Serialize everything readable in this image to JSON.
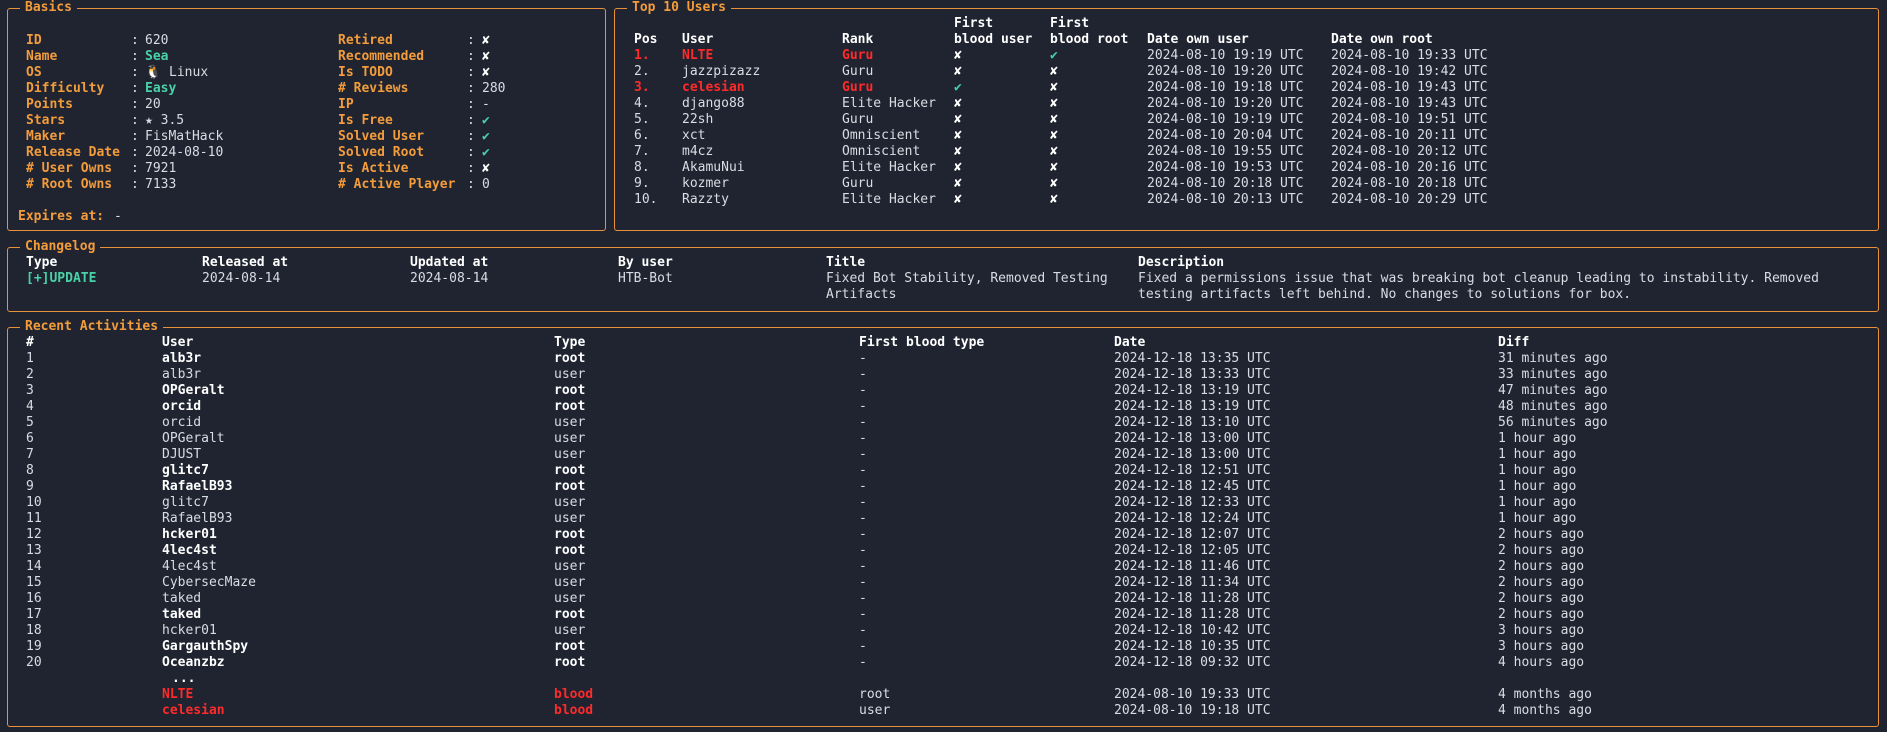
{
  "colors": {
    "accent": "#f39c3c",
    "positive": "#49d2a7",
    "danger": "#ff2a2a",
    "background": "#1f2430"
  },
  "basics": {
    "title": "Basics",
    "left": [
      {
        "label": "ID",
        "value": "620"
      },
      {
        "label": "Name",
        "value": "Sea"
      },
      {
        "label": "OS",
        "value": "🐧 Linux"
      },
      {
        "label": "Difficulty",
        "value": "Easy"
      },
      {
        "label": "Points",
        "value": "20"
      },
      {
        "label": "Stars",
        "value": "★ 3.5"
      },
      {
        "label": "Maker",
        "value": "FisMatHack"
      },
      {
        "label": "Release Date",
        "value": "2024-08-10"
      },
      {
        "label": "# User Owns",
        "value": "7921"
      },
      {
        "label": "# Root Owns",
        "value": "7133"
      }
    ],
    "right": [
      {
        "label": "Retired",
        "value": "✘"
      },
      {
        "label": "Recommended",
        "value": "✘"
      },
      {
        "label": "Is TODO",
        "value": "✘"
      },
      {
        "label": "# Reviews",
        "value": "280"
      },
      {
        "label": "IP",
        "value": "-"
      },
      {
        "label": "Is Free",
        "value": "✔"
      },
      {
        "label": "Solved User",
        "value": "✔"
      },
      {
        "label": "Solved Root",
        "value": "✔"
      },
      {
        "label": "Is Active",
        "value": "✘"
      },
      {
        "label": "# Active Player",
        "value": "0"
      }
    ],
    "expires_label": "Expires at:",
    "expires_value": "-"
  },
  "top_users": {
    "title": "Top 10 Users",
    "headers": {
      "pos": "Pos",
      "user": "User",
      "rank": "Rank",
      "fb_user_1": "First",
      "fb_user_2": "blood user",
      "fb_root_1": "First",
      "fb_root_2": "blood root",
      "date_user": "Date own user",
      "date_root": "Date own root"
    },
    "rows": [
      {
        "pos": "1.",
        "user": "NLTE",
        "rank": "Guru",
        "fbu": "✘",
        "fbr": "✔",
        "du": "2024-08-10 19:19 UTC",
        "dr": "2024-08-10 19:33 UTC",
        "highlight": true
      },
      {
        "pos": "2.",
        "user": "jazzpizazz",
        "rank": "Guru",
        "fbu": "✘",
        "fbr": "✘",
        "du": "2024-08-10 19:20 UTC",
        "dr": "2024-08-10 19:42 UTC",
        "highlight": false
      },
      {
        "pos": "3.",
        "user": "celesian",
        "rank": "Guru",
        "fbu": "✔",
        "fbr": "✘",
        "du": "2024-08-10 19:18 UTC",
        "dr": "2024-08-10 19:43 UTC",
        "highlight": true
      },
      {
        "pos": "4.",
        "user": "django88",
        "rank": "Elite Hacker",
        "fbu": "✘",
        "fbr": "✘",
        "du": "2024-08-10 19:20 UTC",
        "dr": "2024-08-10 19:43 UTC",
        "highlight": false
      },
      {
        "pos": "5.",
        "user": "22sh",
        "rank": "Guru",
        "fbu": "✘",
        "fbr": "✘",
        "du": "2024-08-10 19:19 UTC",
        "dr": "2024-08-10 19:51 UTC",
        "highlight": false
      },
      {
        "pos": "6.",
        "user": "xct",
        "rank": "Omniscient",
        "fbu": "✘",
        "fbr": "✘",
        "du": "2024-08-10 20:04 UTC",
        "dr": "2024-08-10 20:11 UTC",
        "highlight": false
      },
      {
        "pos": "7.",
        "user": "m4cz",
        "rank": "Omniscient",
        "fbu": "✘",
        "fbr": "✘",
        "du": "2024-08-10 19:55 UTC",
        "dr": "2024-08-10 20:12 UTC",
        "highlight": false
      },
      {
        "pos": "8.",
        "user": "AkamuNui",
        "rank": "Elite Hacker",
        "fbu": "✘",
        "fbr": "✘",
        "du": "2024-08-10 19:53 UTC",
        "dr": "2024-08-10 20:16 UTC",
        "highlight": false
      },
      {
        "pos": "9.",
        "user": "kozmer",
        "rank": "Guru",
        "fbu": "✘",
        "fbr": "✘",
        "du": "2024-08-10 20:18 UTC",
        "dr": "2024-08-10 20:18 UTC",
        "highlight": false
      },
      {
        "pos": "10.",
        "user": "Razzty",
        "rank": "Elite Hacker",
        "fbu": "✘",
        "fbr": "✘",
        "du": "2024-08-10 20:13 UTC",
        "dr": "2024-08-10 20:29 UTC",
        "highlight": false
      }
    ]
  },
  "changelog": {
    "title": "Changelog",
    "headers": {
      "type": "Type",
      "released": "Released at",
      "updated": "Updated at",
      "by": "By user",
      "title": "Title",
      "description": "Description"
    },
    "entry": {
      "type": "[+]UPDATE",
      "released": "2024-08-14",
      "updated": "2024-08-14",
      "by": "HTB-Bot",
      "title_1": "Fixed Bot Stability, Removed Testing",
      "title_2": "Artifacts",
      "description_1": "Fixed a permissions issue that was breaking bot cleanup leading to instability. Removed",
      "description_2": "testing artifacts left behind. No changes to solutions for box."
    }
  },
  "activities": {
    "title": "Recent Activities",
    "headers": {
      "num": "#",
      "user": "User",
      "type": "Type",
      "fb": "First blood type",
      "date": "Date",
      "diff": "Diff"
    },
    "rows": [
      {
        "num": "1",
        "user": "alb3r",
        "type": "root",
        "fb": "-",
        "date": "2024-12-18 13:35 UTC",
        "diff": "31 minutes ago"
      },
      {
        "num": "2",
        "user": "alb3r",
        "type": "user",
        "fb": "-",
        "date": "2024-12-18 13:33 UTC",
        "diff": "33 minutes ago"
      },
      {
        "num": "3",
        "user": "OPGeralt",
        "type": "root",
        "fb": "-",
        "date": "2024-12-18 13:19 UTC",
        "diff": "47 minutes ago"
      },
      {
        "num": "4",
        "user": "orcid",
        "type": "root",
        "fb": "-",
        "date": "2024-12-18 13:19 UTC",
        "diff": "48 minutes ago"
      },
      {
        "num": "5",
        "user": "orcid",
        "type": "user",
        "fb": "-",
        "date": "2024-12-18 13:10 UTC",
        "diff": "56 minutes ago"
      },
      {
        "num": "6",
        "user": "OPGeralt",
        "type": "user",
        "fb": "-",
        "date": "2024-12-18 13:00 UTC",
        "diff": "1 hour ago"
      },
      {
        "num": "7",
        "user": "DJUST",
        "type": "user",
        "fb": "-",
        "date": "2024-12-18 13:00 UTC",
        "diff": "1 hour ago"
      },
      {
        "num": "8",
        "user": "glitc7",
        "type": "root",
        "fb": "-",
        "date": "2024-12-18 12:51 UTC",
        "diff": "1 hour ago"
      },
      {
        "num": "9",
        "user": "RafaelB93",
        "type": "root",
        "fb": "-",
        "date": "2024-12-18 12:45 UTC",
        "diff": "1 hour ago"
      },
      {
        "num": "10",
        "user": "glitc7",
        "type": "user",
        "fb": "-",
        "date": "2024-12-18 12:33 UTC",
        "diff": "1 hour ago"
      },
      {
        "num": "11",
        "user": "RafaelB93",
        "type": "user",
        "fb": "-",
        "date": "2024-12-18 12:24 UTC",
        "diff": "1 hour ago"
      },
      {
        "num": "12",
        "user": "hcker01",
        "type": "root",
        "fb": "-",
        "date": "2024-12-18 12:07 UTC",
        "diff": "2 hours ago"
      },
      {
        "num": "13",
        "user": "4lec4st",
        "type": "root",
        "fb": "-",
        "date": "2024-12-18 12:05 UTC",
        "diff": "2 hours ago"
      },
      {
        "num": "14",
        "user": "4lec4st",
        "type": "user",
        "fb": "-",
        "date": "2024-12-18 11:46 UTC",
        "diff": "2 hours ago"
      },
      {
        "num": "15",
        "user": "CybersecMaze",
        "type": "user",
        "fb": "-",
        "date": "2024-12-18 11:34 UTC",
        "diff": "2 hours ago"
      },
      {
        "num": "16",
        "user": "taked",
        "type": "user",
        "fb": "-",
        "date": "2024-12-18 11:28 UTC",
        "diff": "2 hours ago"
      },
      {
        "num": "17",
        "user": "taked",
        "type": "root",
        "fb": "-",
        "date": "2024-12-18 11:28 UTC",
        "diff": "2 hours ago"
      },
      {
        "num": "18",
        "user": "hcker01",
        "type": "user",
        "fb": "-",
        "date": "2024-12-18 10:42 UTC",
        "diff": "3 hours ago"
      },
      {
        "num": "19",
        "user": "GargauthSpy",
        "type": "root",
        "fb": "-",
        "date": "2024-12-18 10:35 UTC",
        "diff": "3 hours ago"
      },
      {
        "num": "20",
        "user": "Oceanzbz",
        "type": "root",
        "fb": "-",
        "date": "2024-12-18 09:32 UTC",
        "diff": "4 hours ago"
      }
    ],
    "ellipsis": "...",
    "blood_rows": [
      {
        "user": "NLTE",
        "type": "blood",
        "fb": "root",
        "date": "2024-08-10 19:33 UTC",
        "diff": "4 months ago"
      },
      {
        "user": "celesian",
        "type": "blood",
        "fb": "user",
        "date": "2024-08-10 19:18 UTC",
        "diff": "4 months ago"
      }
    ]
  }
}
